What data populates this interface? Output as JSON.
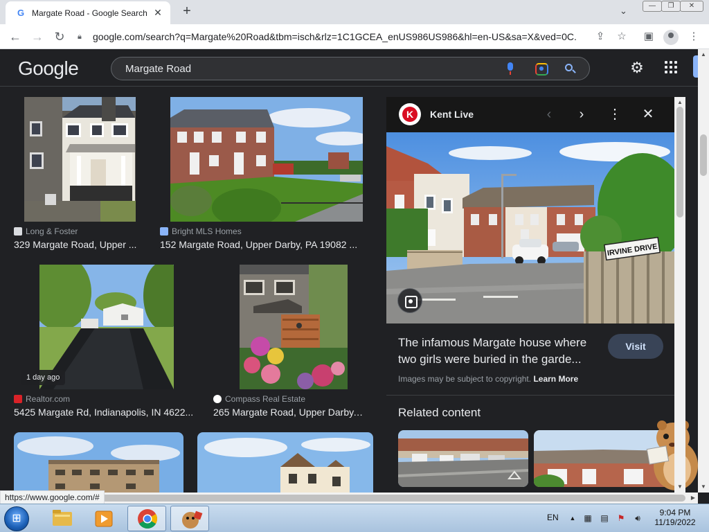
{
  "browser": {
    "tab_title": "Margate Road - Google Search",
    "tab_favicon": "G",
    "tab_close": "✕",
    "new_tab": "+",
    "url": "google.com/search?q=Margate%20Road&tbm=isch&rlz=1C1GCEA_enUS986US986&hl=en-US&sa=X&ved=0C...",
    "status_url": "https://www.google.com/#"
  },
  "google": {
    "logo": "Google",
    "query": "Margate Road"
  },
  "results": [
    {
      "source": "Long & Foster",
      "caption": "329 Margate Road, Upper ...",
      "icon_color": "#dadce0"
    },
    {
      "source": "Bright MLS Homes",
      "caption": "152 Margate Road, Upper Darby, PA 19082 ...",
      "icon_color": "#8ab4f8"
    },
    {
      "source": "Realtor.com",
      "caption": "5425 Margate Rd, Indianapolis, IN 4622...",
      "icon_color": "#d92228",
      "badge": "1 day ago"
    },
    {
      "source": "Compass Real Estate",
      "caption": "265 Margate Road, Upper Darby, ...",
      "icon_color": "#ffffff"
    }
  ],
  "preview": {
    "site": "Kent Live",
    "logo_letter": "K",
    "title": "The infamous Margate house where two girls were buried in the garde...",
    "visit": "Visit",
    "copyright": "Images may be subject to copyright.",
    "learn_more": "Learn More",
    "related_title": "Related content",
    "street_sign": "IRVINE DRIVE"
  },
  "taskbar": {
    "lang": "EN",
    "time": "9:04 PM",
    "date": "11/19/2022"
  },
  "colors": {
    "page_bg": "#202124",
    "text": "#e8eaed",
    "muted": "#9aa0a6",
    "accent": "#8ab4f8",
    "kent_red": "#d90d22"
  }
}
